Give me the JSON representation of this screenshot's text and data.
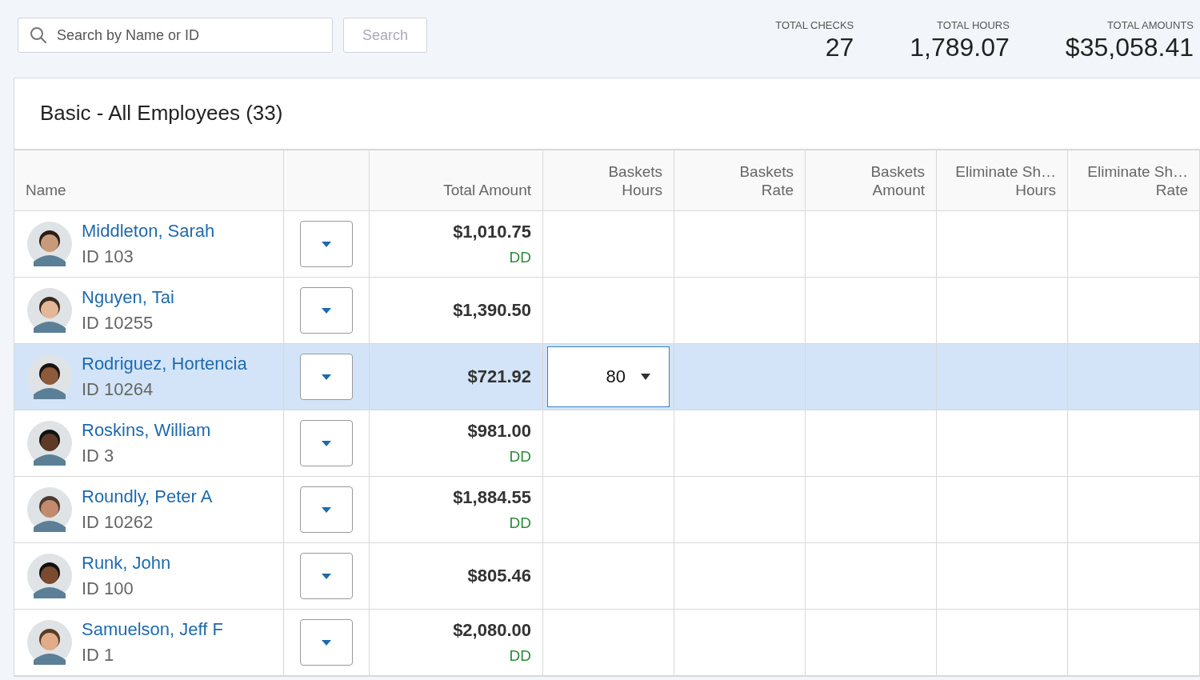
{
  "search": {
    "placeholder": "Search by Name or ID",
    "button": "Search"
  },
  "totals": [
    {
      "label": "TOTAL CHECKS",
      "value": "27"
    },
    {
      "label": "TOTAL HOURS",
      "value": "1,789.07"
    },
    {
      "label": "TOTAL AMOUNTS",
      "value": "$35,058.41"
    }
  ],
  "table": {
    "title": "Basic - All Employees (33)",
    "columns": [
      {
        "lines": [
          "Name"
        ]
      },
      {},
      {
        "lines": [
          "Total Amount"
        ]
      },
      {
        "lines": [
          "Baskets",
          "Hours"
        ]
      },
      {
        "lines": [
          "Baskets",
          "Rate"
        ]
      },
      {
        "lines": [
          "Baskets",
          "Amount"
        ]
      },
      {
        "lines": [
          "Eliminate Sh…",
          "Hours"
        ]
      },
      {
        "lines": [
          "Eliminate Sh…",
          "Rate"
        ]
      }
    ],
    "rows": [
      {
        "name": "Middleton, Sarah",
        "id": "ID 103",
        "amount": "$1,010.75",
        "payment": "DD",
        "selected": false
      },
      {
        "name": "Nguyen, Tai",
        "id": "ID 10255",
        "amount": "$1,390.50",
        "selected": false
      },
      {
        "name": "Rodriguez, Hortencia",
        "id": "ID 10264",
        "amount": "$721.92",
        "selected": true,
        "baskets_hours": "80"
      },
      {
        "name": "Roskins, William",
        "id": "ID 3",
        "amount": "$981.00",
        "payment": "DD",
        "selected": false
      },
      {
        "name": "Roundly, Peter A",
        "id": "ID 10262",
        "amount": "$1,884.55",
        "payment": "DD",
        "selected": false
      },
      {
        "name": "Runk, John",
        "id": "ID 100",
        "amount": "$805.46",
        "selected": false
      },
      {
        "name": "Samuelson, Jeff F",
        "id": "ID 1",
        "amount": "$2,080.00",
        "payment": "DD",
        "selected": false
      }
    ]
  }
}
